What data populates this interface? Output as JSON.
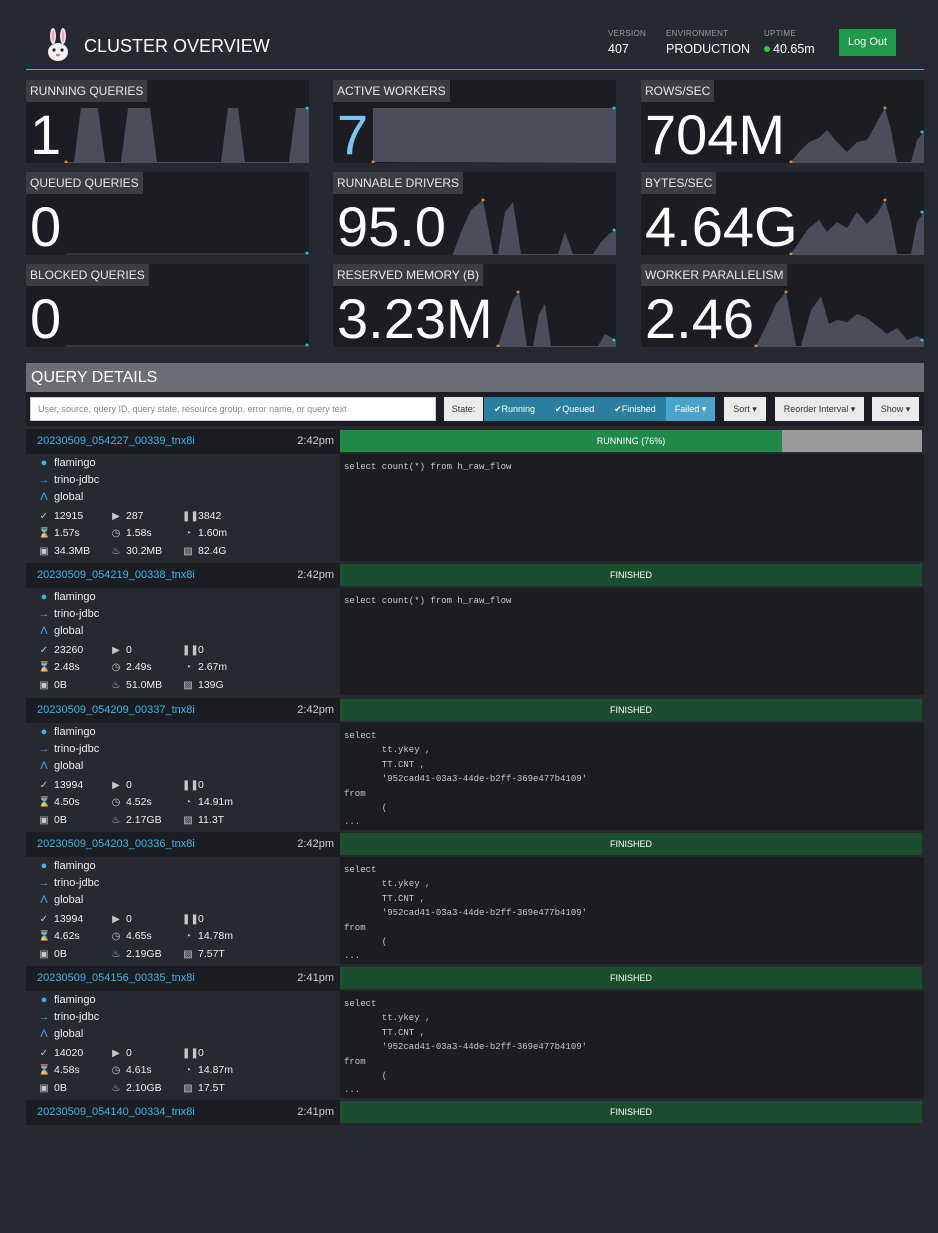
{
  "header": {
    "title": "CLUSTER OVERVIEW",
    "version_label": "VERSION",
    "version": "407",
    "environment_label": "ENVIRONMENT",
    "environment": "PRODUCTION",
    "uptime_label": "UPTIME",
    "uptime": "40.65m",
    "logout_label": "Log Out",
    "accent": "#1ec8e0"
  },
  "metrics": {
    "running_queries": {
      "label": "RUNNING QUERIES",
      "value": "1"
    },
    "active_workers": {
      "label": "ACTIVE WORKERS",
      "value": "7"
    },
    "rows_sec": {
      "label": "ROWS/SEC",
      "value": "704M"
    },
    "queued_queries": {
      "label": "QUEUED QUERIES",
      "value": "0"
    },
    "runnable_drivers": {
      "label": "RUNNABLE DRIVERS",
      "value": "95.0"
    },
    "bytes_sec": {
      "label": "BYTES/SEC",
      "value": "4.64G"
    },
    "blocked_queries": {
      "label": "BLOCKED QUERIES",
      "value": "0"
    },
    "reserved_memory": {
      "label": "RESERVED MEMORY (B)",
      "value": "3.23M"
    },
    "worker_parallelism": {
      "label": "WORKER PARALLELISM",
      "value": "2.46"
    }
  },
  "query_details": {
    "title": "QUERY DETAILS",
    "search_placeholder": "User, source, query ID, query state, resource group, error name, or query text",
    "state_label": "State:",
    "state_filters": [
      "✔Running",
      "✔Queued",
      "✔Finished",
      "Failed ▾"
    ],
    "sort_label": "Sort ▾",
    "reorder_label": "Reorder Interval ▾",
    "show_label": "Show ▾"
  },
  "queries": [
    {
      "id": "20230509_054227_00339_tnx8i",
      "time": "2:42pm",
      "state": "RUNNING (76%)",
      "progress": 0.76,
      "user": "flamingo",
      "source": "trino-jdbc",
      "resource_group": "global",
      "completed_splits": "12915",
      "running_splits": "287",
      "queued_splits": "3842",
      "wall_time": "1.57s",
      "elapsed": "1.58s",
      "cpu": "1.60m",
      "memory": "34.3MB",
      "peak_memory": "30.2MB",
      "input": "82.4G",
      "sql": "select count(*) from h_raw_flow"
    },
    {
      "id": "20230509_054219_00338_tnx8i",
      "time": "2:42pm",
      "state": "FINISHED",
      "progress": 1,
      "user": "flamingo",
      "source": "trino-jdbc",
      "resource_group": "global",
      "completed_splits": "23260",
      "running_splits": "0",
      "queued_splits": "0",
      "wall_time": "2.48s",
      "elapsed": "2.49s",
      "cpu": "2.67m",
      "memory": "0B",
      "peak_memory": "51.0MB",
      "input": "139G",
      "sql": "select count(*) from h_raw_flow"
    },
    {
      "id": "20230509_054209_00337_tnx8i",
      "time": "2:42pm",
      "state": "FINISHED",
      "progress": 1,
      "user": "flamingo",
      "source": "trino-jdbc",
      "resource_group": "global",
      "completed_splits": "13994",
      "running_splits": "0",
      "queued_splits": "0",
      "wall_time": "4.50s",
      "elapsed": "4.52s",
      "cpu": "14.91m",
      "memory": "0B",
      "peak_memory": "2.17GB",
      "input": "11.3T",
      "sql": "select\n       tt.ykey ,\n       TT.CNT ,\n       '952cad41-03a3-44de-b2ff-369e477b4109'\nfrom\n       (\n..."
    },
    {
      "id": "20230509_054203_00336_tnx8i",
      "time": "2:42pm",
      "state": "FINISHED",
      "progress": 1,
      "user": "flamingo",
      "source": "trino-jdbc",
      "resource_group": "global",
      "completed_splits": "13994",
      "running_splits": "0",
      "queued_splits": "0",
      "wall_time": "4.62s",
      "elapsed": "4.65s",
      "cpu": "14.78m",
      "memory": "0B",
      "peak_memory": "2.19GB",
      "input": "7.57T",
      "sql": "select\n       tt.ykey ,\n       TT.CNT ,\n       '952cad41-03a3-44de-b2ff-369e477b4109'\nfrom\n       (\n..."
    },
    {
      "id": "20230509_054156_00335_tnx8i",
      "time": "2:41pm",
      "state": "FINISHED",
      "progress": 1,
      "user": "flamingo",
      "source": "trino-jdbc",
      "resource_group": "global",
      "completed_splits": "14020",
      "running_splits": "0",
      "queued_splits": "0",
      "wall_time": "4.58s",
      "elapsed": "4.61s",
      "cpu": "14.87m",
      "memory": "0B",
      "peak_memory": "2.10GB",
      "input": "17.5T",
      "sql": "select\n       tt.ykey ,\n       TT.CNT ,\n       '952cad41-03a3-44de-b2ff-369e477b4109'\nfrom\n       (\n..."
    },
    {
      "id": "20230509_054140_00334_tnx8i",
      "time": "2:41pm",
      "state": "FINISHED",
      "progress": 1,
      "user": "",
      "source": "",
      "resource_group": "",
      "completed_splits": "",
      "running_splits": "",
      "queued_splits": "",
      "wall_time": "",
      "elapsed": "",
      "cpu": "",
      "memory": "",
      "peak_memory": "",
      "input": "",
      "sql": ""
    }
  ],
  "colors": {
    "running": "#218a48",
    "finished": "#1b4d2f",
    "link": "#38b6e8",
    "sparkline": "#4a4e5a"
  }
}
